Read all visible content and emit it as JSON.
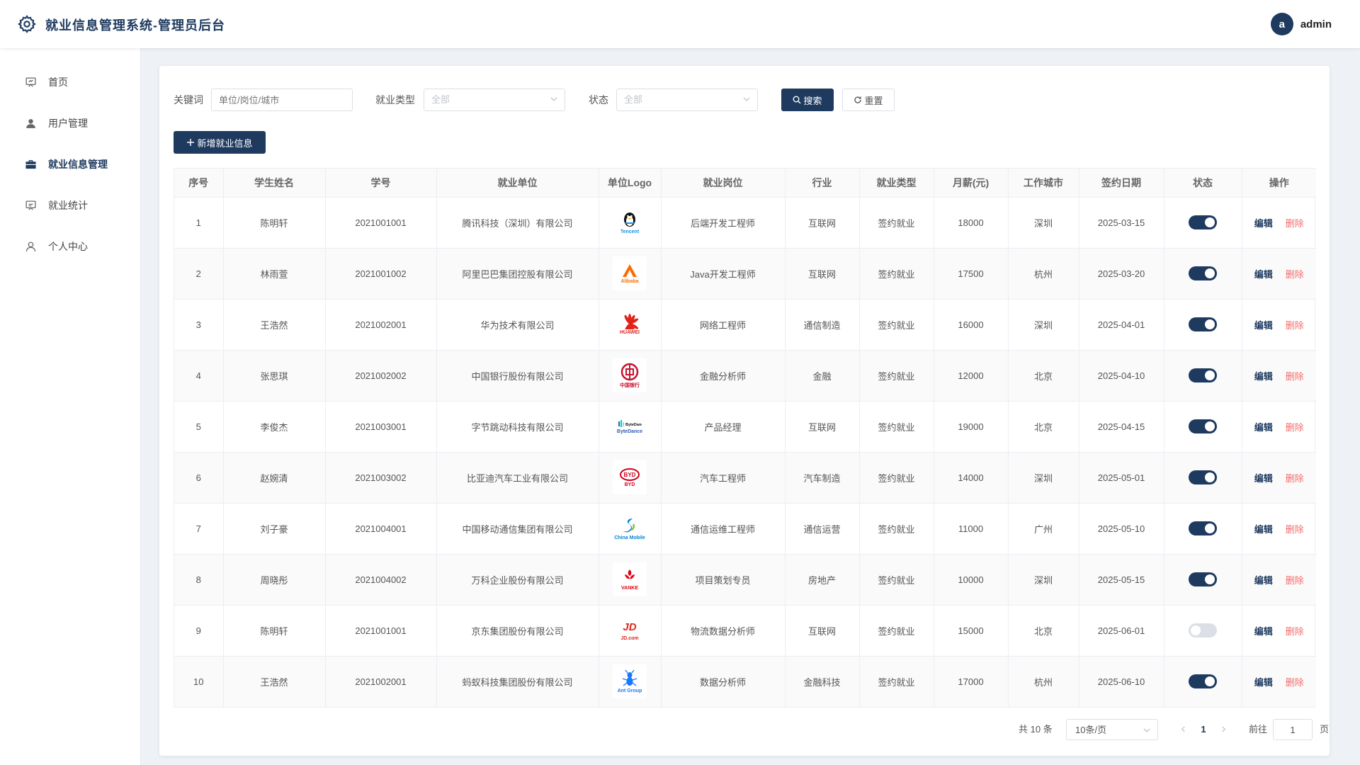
{
  "header": {
    "title": "就业信息管理系统-管理员后台",
    "avatar_letter": "a",
    "username": "admin"
  },
  "sidebar": {
    "items": [
      {
        "label": "首页",
        "icon": "presentation-icon"
      },
      {
        "label": "用户管理",
        "icon": "user-icon"
      },
      {
        "label": "就业信息管理",
        "icon": "briefcase-icon",
        "active": true
      },
      {
        "label": "就业统计",
        "icon": "chart-board-icon"
      },
      {
        "label": "个人中心",
        "icon": "person-outline-icon"
      }
    ]
  },
  "filters": {
    "keyword_label": "关键词",
    "keyword_placeholder": "单位/岗位/城市",
    "type_label": "就业类型",
    "type_value": "全部",
    "status_label": "状态",
    "status_value": "全部",
    "search_label": "搜索",
    "reset_label": "重置"
  },
  "toolbar": {
    "add_label": "新增就业信息"
  },
  "table": {
    "headers": [
      "序号",
      "学生姓名",
      "学号",
      "就业单位",
      "单位Logo",
      "就业岗位",
      "行业",
      "就业类型",
      "月薪(元)",
      "工作城市",
      "签约日期",
      "状态",
      "操作"
    ],
    "rows": [
      {
        "no": "1",
        "name": "陈明轩",
        "sid": "2021001001",
        "company": "腾讯科技（深圳）有限公司",
        "logo": "Tencent",
        "position": "后端开发工程师",
        "industry": "互联网",
        "type": "签约就业",
        "salary": "18000",
        "city": "深圳",
        "date": "2025-03-15",
        "enabled": true
      },
      {
        "no": "2",
        "name": "林雨萱",
        "sid": "2021001002",
        "company": "阿里巴巴集团控股有限公司",
        "logo": "Alibaba",
        "position": "Java开发工程师",
        "industry": "互联网",
        "type": "签约就业",
        "salary": "17500",
        "city": "杭州",
        "date": "2025-03-20",
        "enabled": true
      },
      {
        "no": "3",
        "name": "王浩然",
        "sid": "2021002001",
        "company": "华为技术有限公司",
        "logo": "HUAWEI",
        "position": "网络工程师",
        "industry": "通信制造",
        "type": "签约就业",
        "salary": "16000",
        "city": "深圳",
        "date": "2025-04-01",
        "enabled": true
      },
      {
        "no": "4",
        "name": "张思琪",
        "sid": "2021002002",
        "company": "中国银行股份有限公司",
        "logo": "中国银行",
        "position": "金融分析师",
        "industry": "金融",
        "type": "签约就业",
        "salary": "12000",
        "city": "北京",
        "date": "2025-04-10",
        "enabled": true
      },
      {
        "no": "5",
        "name": "李俊杰",
        "sid": "2021003001",
        "company": "字节跳动科技有限公司",
        "logo": "ByteDance",
        "position": "产品经理",
        "industry": "互联网",
        "type": "签约就业",
        "salary": "19000",
        "city": "北京",
        "date": "2025-04-15",
        "enabled": true
      },
      {
        "no": "6",
        "name": "赵婉清",
        "sid": "2021003002",
        "company": "比亚迪汽车工业有限公司",
        "logo": "BYD",
        "position": "汽车工程师",
        "industry": "汽车制造",
        "type": "签约就业",
        "salary": "14000",
        "city": "深圳",
        "date": "2025-05-01",
        "enabled": true
      },
      {
        "no": "7",
        "name": "刘子豪",
        "sid": "2021004001",
        "company": "中国移动通信集团有限公司",
        "logo": "China Mobile",
        "position": "通信运维工程师",
        "industry": "通信运营",
        "type": "签约就业",
        "salary": "11000",
        "city": "广州",
        "date": "2025-05-10",
        "enabled": true
      },
      {
        "no": "8",
        "name": "周晓彤",
        "sid": "2021004002",
        "company": "万科企业股份有限公司",
        "logo": "VANKE",
        "position": "项目策划专员",
        "industry": "房地产",
        "type": "签约就业",
        "salary": "10000",
        "city": "深圳",
        "date": "2025-05-15",
        "enabled": true
      },
      {
        "no": "9",
        "name": "陈明轩",
        "sid": "2021001001",
        "company": "京东集团股份有限公司",
        "logo": "JD.com",
        "position": "物流数据分析师",
        "industry": "互联网",
        "type": "签约就业",
        "salary": "15000",
        "city": "北京",
        "date": "2025-06-01",
        "enabled": false
      },
      {
        "no": "10",
        "name": "王浩然",
        "sid": "2021002001",
        "company": "蚂蚁科技集团股份有限公司",
        "logo": "Ant Group",
        "position": "数据分析师",
        "industry": "金融科技",
        "type": "签约就业",
        "salary": "17000",
        "city": "杭州",
        "date": "2025-06-10",
        "enabled": true
      }
    ],
    "edit_label": "编辑",
    "delete_label": "删除"
  },
  "pagination": {
    "total": "共 10 条",
    "page_size": "10条/页",
    "current": "1",
    "goto_label": "前往",
    "goto_value": "1",
    "page_suffix": "页"
  },
  "colors": {
    "primary": "#1e3a5f",
    "danger": "#f56c6c"
  }
}
